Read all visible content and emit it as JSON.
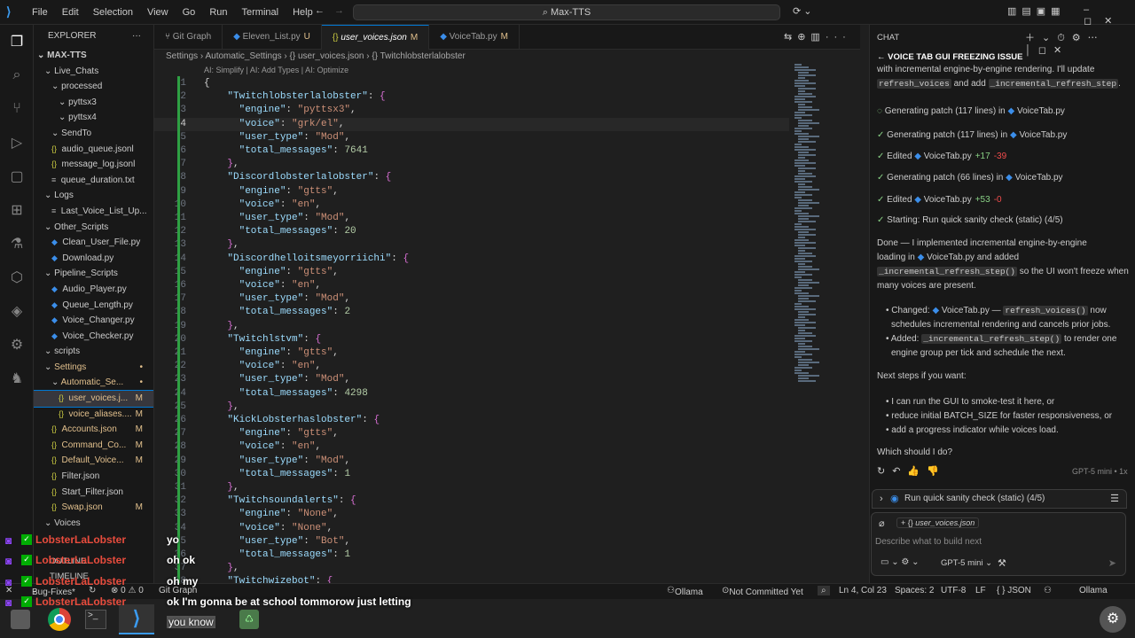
{
  "titlebar": {
    "menu": [
      "File",
      "Edit",
      "Selection",
      "View",
      "Go",
      "Run",
      "Terminal",
      "Help"
    ],
    "search": "Max-TTS"
  },
  "explorer": {
    "header": "EXPLORER",
    "root": "MAX-TTS",
    "items": [
      {
        "label": "Live_Chats",
        "indent": 1,
        "badge": "",
        "icon": "chevron"
      },
      {
        "label": "processed",
        "indent": 2,
        "badge": "",
        "icon": "chevron"
      },
      {
        "label": "pyttsx3",
        "indent": 3,
        "badge": "",
        "icon": "chevron"
      },
      {
        "label": "pyttsx4",
        "indent": 3,
        "badge": "",
        "icon": "chevron"
      },
      {
        "label": "SendTo",
        "indent": 2,
        "badge": "",
        "icon": "chevron"
      },
      {
        "label": "audio_queue.jsonl",
        "indent": 2,
        "badge": "",
        "icon": "json"
      },
      {
        "label": "message_log.jsonl",
        "indent": 2,
        "badge": "",
        "icon": "json"
      },
      {
        "label": "queue_duration.txt",
        "indent": 2,
        "badge": "",
        "icon": "txt"
      },
      {
        "label": "Logs",
        "indent": 1,
        "badge": "",
        "icon": "chevron"
      },
      {
        "label": "Last_Voice_List_Up...",
        "indent": 2,
        "badge": "",
        "icon": "txt"
      },
      {
        "label": "Other_Scripts",
        "indent": 1,
        "badge": "",
        "icon": "chevron"
      },
      {
        "label": "Clean_User_File.py",
        "indent": 2,
        "badge": "",
        "icon": "py"
      },
      {
        "label": "Download.py",
        "indent": 2,
        "badge": "",
        "icon": "py"
      },
      {
        "label": "Pipeline_Scripts",
        "indent": 1,
        "badge": "",
        "icon": "chevron"
      },
      {
        "label": "Audio_Player.py",
        "indent": 2,
        "badge": "",
        "icon": "py"
      },
      {
        "label": "Queue_Length.py",
        "indent": 2,
        "badge": "",
        "icon": "py"
      },
      {
        "label": "Voice_Changer.py",
        "indent": 2,
        "badge": "",
        "icon": "py"
      },
      {
        "label": "Voice_Checker.py",
        "indent": 2,
        "badge": "",
        "icon": "py"
      },
      {
        "label": "scripts",
        "indent": 1,
        "badge": "",
        "icon": "chevron"
      },
      {
        "label": "Settings",
        "indent": 1,
        "badge": "•",
        "icon": "chevron"
      },
      {
        "label": "Automatic_Se...",
        "indent": 2,
        "badge": "•",
        "icon": "chevron"
      },
      {
        "label": "user_voices.j...",
        "indent": 3,
        "badge": "M",
        "icon": "json",
        "selected": true
      },
      {
        "label": "voice_aliases....",
        "indent": 3,
        "badge": "M",
        "icon": "json"
      },
      {
        "label": "Accounts.json",
        "indent": 2,
        "badge": "M",
        "icon": "json"
      },
      {
        "label": "Command_Co...",
        "indent": 2,
        "badge": "M",
        "icon": "json"
      },
      {
        "label": "Default_Voice...",
        "indent": 2,
        "badge": "M",
        "icon": "json"
      },
      {
        "label": "Filter.json",
        "indent": 2,
        "badge": "",
        "icon": "json"
      },
      {
        "label": "Start_Filter.json",
        "indent": 2,
        "badge": "",
        "icon": "json"
      },
      {
        "label": "Swap.json",
        "indent": 2,
        "badge": "M",
        "icon": "json"
      },
      {
        "label": "Voices",
        "indent": 1,
        "badge": "",
        "icon": "chevron"
      }
    ],
    "outline": "OUTLINE",
    "timeline": "TIMELINE"
  },
  "tabs": [
    {
      "label": "Git Graph",
      "mod": "",
      "active": false
    },
    {
      "label": "Eleven_List.py",
      "mod": "U",
      "active": false
    },
    {
      "label": "user_voices.json",
      "mod": "M",
      "active": true
    },
    {
      "label": "VoiceTab.py",
      "mod": "M",
      "active": false
    }
  ],
  "breadcrumb": "Settings  ›  Automatic_Settings  ›  {} user_voices.json  ›  {} Twitchlobsterlalobster",
  "codelens": "AI: Simplify | AI: Add Types | AI: Optimize",
  "code_lines": [
    {
      "n": "1",
      "t": [
        [
          "p",
          "{"
        ]
      ]
    },
    {
      "n": "2",
      "t": [
        [
          "p",
          "    "
        ],
        [
          "k",
          "\"Twitchlobsterlalobster\""
        ],
        [
          "p",
          ": "
        ],
        [
          "b",
          "{"
        ]
      ]
    },
    {
      "n": "3",
      "t": [
        [
          "p",
          "      "
        ],
        [
          "k",
          "\"engine\""
        ],
        [
          "p",
          ": "
        ],
        [
          "s",
          "\"pyttsx3\""
        ],
        [
          "p",
          ","
        ]
      ]
    },
    {
      "n": "4",
      "t": [
        [
          "p",
          "      "
        ],
        [
          "k",
          "\"voice\""
        ],
        [
          "p",
          ": "
        ],
        [
          "s",
          "\"grk/el\""
        ],
        [
          "p",
          ","
        ]
      ]
    },
    {
      "n": "5",
      "t": [
        [
          "p",
          "      "
        ],
        [
          "k",
          "\"user_type\""
        ],
        [
          "p",
          ": "
        ],
        [
          "s",
          "\"Mod\""
        ],
        [
          "p",
          ","
        ]
      ]
    },
    {
      "n": "6",
      "t": [
        [
          "p",
          "      "
        ],
        [
          "k",
          "\"total_messages\""
        ],
        [
          "p",
          ": "
        ],
        [
          "n",
          "7641"
        ]
      ]
    },
    {
      "n": "7",
      "t": [
        [
          "p",
          "    "
        ],
        [
          "b",
          "}"
        ],
        [
          "p",
          ","
        ]
      ]
    },
    {
      "n": "8",
      "t": [
        [
          "p",
          "    "
        ],
        [
          "k",
          "\"Discordlobsterlalobster\""
        ],
        [
          "p",
          ": "
        ],
        [
          "b",
          "{"
        ]
      ]
    },
    {
      "n": "9",
      "t": [
        [
          "p",
          "      "
        ],
        [
          "k",
          "\"engine\""
        ],
        [
          "p",
          ": "
        ],
        [
          "s",
          "\"gtts\""
        ],
        [
          "p",
          ","
        ]
      ]
    },
    {
      "n": "10",
      "t": [
        [
          "p",
          "      "
        ],
        [
          "k",
          "\"voice\""
        ],
        [
          "p",
          ": "
        ],
        [
          "s",
          "\"en\""
        ],
        [
          "p",
          ","
        ]
      ]
    },
    {
      "n": "11",
      "t": [
        [
          "p",
          "      "
        ],
        [
          "k",
          "\"user_type\""
        ],
        [
          "p",
          ": "
        ],
        [
          "s",
          "\"Mod\""
        ],
        [
          "p",
          ","
        ]
      ]
    },
    {
      "n": "12",
      "t": [
        [
          "p",
          "      "
        ],
        [
          "k",
          "\"total_messages\""
        ],
        [
          "p",
          ": "
        ],
        [
          "n",
          "20"
        ]
      ]
    },
    {
      "n": "13",
      "t": [
        [
          "p",
          "    "
        ],
        [
          "b",
          "}"
        ],
        [
          "p",
          ","
        ]
      ]
    },
    {
      "n": "14",
      "t": [
        [
          "p",
          "    "
        ],
        [
          "k",
          "\"Discordhelloitsmeyorriichi\""
        ],
        [
          "p",
          ": "
        ],
        [
          "b",
          "{"
        ]
      ]
    },
    {
      "n": "15",
      "t": [
        [
          "p",
          "      "
        ],
        [
          "k",
          "\"engine\""
        ],
        [
          "p",
          ": "
        ],
        [
          "s",
          "\"gtts\""
        ],
        [
          "p",
          ","
        ]
      ]
    },
    {
      "n": "16",
      "t": [
        [
          "p",
          "      "
        ],
        [
          "k",
          "\"voice\""
        ],
        [
          "p",
          ": "
        ],
        [
          "s",
          "\"en\""
        ],
        [
          "p",
          ","
        ]
      ]
    },
    {
      "n": "17",
      "t": [
        [
          "p",
          "      "
        ],
        [
          "k",
          "\"user_type\""
        ],
        [
          "p",
          ": "
        ],
        [
          "s",
          "\"Mod\""
        ],
        [
          "p",
          ","
        ]
      ]
    },
    {
      "n": "18",
      "t": [
        [
          "p",
          "      "
        ],
        [
          "k",
          "\"total_messages\""
        ],
        [
          "p",
          ": "
        ],
        [
          "n",
          "2"
        ]
      ]
    },
    {
      "n": "19",
      "t": [
        [
          "p",
          "    "
        ],
        [
          "b",
          "}"
        ],
        [
          "p",
          ","
        ]
      ]
    },
    {
      "n": "20",
      "t": [
        [
          "p",
          "    "
        ],
        [
          "k",
          "\"Twitchlstvm\""
        ],
        [
          "p",
          ": "
        ],
        [
          "b",
          "{"
        ]
      ]
    },
    {
      "n": "21",
      "t": [
        [
          "p",
          "      "
        ],
        [
          "k",
          "\"engine\""
        ],
        [
          "p",
          ": "
        ],
        [
          "s",
          "\"gtts\""
        ],
        [
          "p",
          ","
        ]
      ]
    },
    {
      "n": "22",
      "t": [
        [
          "p",
          "      "
        ],
        [
          "k",
          "\"voice\""
        ],
        [
          "p",
          ": "
        ],
        [
          "s",
          "\"en\""
        ],
        [
          "p",
          ","
        ]
      ]
    },
    {
      "n": "23",
      "t": [
        [
          "p",
          "      "
        ],
        [
          "k",
          "\"user_type\""
        ],
        [
          "p",
          ": "
        ],
        [
          "s",
          "\"Mod\""
        ],
        [
          "p",
          ","
        ]
      ]
    },
    {
      "n": "24",
      "t": [
        [
          "p",
          "      "
        ],
        [
          "k",
          "\"total_messages\""
        ],
        [
          "p",
          ": "
        ],
        [
          "n",
          "4298"
        ]
      ]
    },
    {
      "n": "25",
      "t": [
        [
          "p",
          "    "
        ],
        [
          "b",
          "}"
        ],
        [
          "p",
          ","
        ]
      ]
    },
    {
      "n": "26",
      "t": [
        [
          "p",
          "    "
        ],
        [
          "k",
          "\"KickLobsterhaslobster\""
        ],
        [
          "p",
          ": "
        ],
        [
          "b",
          "{"
        ]
      ]
    },
    {
      "n": "27",
      "t": [
        [
          "p",
          "      "
        ],
        [
          "k",
          "\"engine\""
        ],
        [
          "p",
          ": "
        ],
        [
          "s",
          "\"gtts\""
        ],
        [
          "p",
          ","
        ]
      ]
    },
    {
      "n": "28",
      "t": [
        [
          "p",
          "      "
        ],
        [
          "k",
          "\"voice\""
        ],
        [
          "p",
          ": "
        ],
        [
          "s",
          "\"en\""
        ],
        [
          "p",
          ","
        ]
      ]
    },
    {
      "n": "29",
      "t": [
        [
          "p",
          "      "
        ],
        [
          "k",
          "\"user_type\""
        ],
        [
          "p",
          ": "
        ],
        [
          "s",
          "\"Mod\""
        ],
        [
          "p",
          ","
        ]
      ]
    },
    {
      "n": "30",
      "t": [
        [
          "p",
          "      "
        ],
        [
          "k",
          "\"total_messages\""
        ],
        [
          "p",
          ": "
        ],
        [
          "n",
          "1"
        ]
      ]
    },
    {
      "n": "31",
      "t": [
        [
          "p",
          "    "
        ],
        [
          "b",
          "}"
        ],
        [
          "p",
          ","
        ]
      ]
    },
    {
      "n": "32",
      "t": [
        [
          "p",
          "    "
        ],
        [
          "k",
          "\"Twitchsoundalerts\""
        ],
        [
          "p",
          ": "
        ],
        [
          "b",
          "{"
        ]
      ]
    },
    {
      "n": "33",
      "t": [
        [
          "p",
          "      "
        ],
        [
          "k",
          "\"engine\""
        ],
        [
          "p",
          ": "
        ],
        [
          "s",
          "\"None\""
        ],
        [
          "p",
          ","
        ]
      ]
    },
    {
      "n": "34",
      "t": [
        [
          "p",
          "      "
        ],
        [
          "k",
          "\"voice\""
        ],
        [
          "p",
          ": "
        ],
        [
          "s",
          "\"None\""
        ],
        [
          "p",
          ","
        ]
      ]
    },
    {
      "n": "35",
      "t": [
        [
          "p",
          "      "
        ],
        [
          "k",
          "\"user_type\""
        ],
        [
          "p",
          ": "
        ],
        [
          "s",
          "\"Bot\""
        ],
        [
          "p",
          ","
        ]
      ]
    },
    {
      "n": "36",
      "t": [
        [
          "p",
          "      "
        ],
        [
          "k",
          "\"total_messages\""
        ],
        [
          "p",
          ": "
        ],
        [
          "n",
          "1"
        ]
      ]
    },
    {
      "n": "37",
      "t": [
        [
          "p",
          "    "
        ],
        [
          "b",
          "}"
        ],
        [
          "p",
          ","
        ]
      ]
    },
    {
      "n": "38",
      "t": [
        [
          "p",
          "    "
        ],
        [
          "k",
          "\"Twitchwizebot\""
        ],
        [
          "p",
          ": "
        ],
        [
          "b",
          "{"
        ]
      ]
    }
  ],
  "chat": {
    "title": "CHAT",
    "thread_title": "VOICE TAB GUI FREEZING ISSUE",
    "intro1": "with incremental engine-by-engine rendering. I'll update",
    "intro2_a": "refresh_voices",
    "intro2_b": " and add ",
    "intro2_c": "_incremental_refresh_step",
    "intro2_d": ".",
    "steps": [
      {
        "text": "Generating patch (117 lines) in",
        "file": "VoiceTab.py",
        "diff": "",
        "running": true
      },
      {
        "text": "Generating patch (117 lines) in",
        "file": "VoiceTab.py",
        "diff": ""
      },
      {
        "text": "Edited",
        "file": "VoiceTab.py",
        "plus": "+17",
        "minus": "-39"
      },
      {
        "text": "Generating patch (66 lines) in",
        "file": "VoiceTab.py",
        "diff": ""
      },
      {
        "text": "Edited",
        "file": "VoiceTab.py",
        "plus": "+53",
        "minus": "-0"
      },
      {
        "text": "Starting: Run quick sanity check (static) (4/5)",
        "file": "",
        "diff": ""
      }
    ],
    "done1": "Done — I implemented incremental engine-by-engine",
    "done2_a": "loading in",
    "done2_file": "VoiceTab.py",
    "done2_b": "and added",
    "done3_code": "_incremental_refresh_step()",
    "done3_b": "so the UI won't freeze when",
    "done4": "many voices are present.",
    "changed_label": "Changed:",
    "changed_file": "VoiceTab.py",
    "changed_dash": "—",
    "changed_code": "refresh_voices()",
    "changed_rest": "now",
    "changed_line2": "schedules incremental rendering and cancels prior jobs.",
    "added_label": "Added:",
    "added_code": "_incremental_refresh_step()",
    "added_rest": "to render one",
    "added_line2": "engine group per tick and schedule the next.",
    "next_steps": "Next steps if you want:",
    "options": [
      "I can run the GUI to smoke-test it here, or",
      "reduce initial BATCH_SIZE for faster responsiveness, or",
      "add a progress indicator while voices load."
    ],
    "question": "Which should I do?",
    "model_tag": "GPT-5 mini • 1x",
    "todo": "Run quick sanity check (static) (4/5)",
    "attachment": "user_voices.json",
    "placeholder": "Describe what to build next",
    "model_select": "GPT-5 mini"
  },
  "statusbar": {
    "branch": "Bug-Fixes*",
    "problems": "⊗ 0 ⚠ 0",
    "gitgraph": "Git Graph",
    "ollama1": "Ollama",
    "not_committed": "Not Committed Yet",
    "position": "Ln 4, Col 23",
    "spaces": "Spaces: 2",
    "encoding": "UTF-8",
    "eol": "LF",
    "language": "{ } JSON",
    "ollama2": "Ollama"
  },
  "overlay": [
    {
      "name": "LobsterLaLobster",
      "msg": "yo"
    },
    {
      "name": "LobsterLaLobster",
      "msg": "oh ok"
    },
    {
      "name": "LobsterLaLobster",
      "msg": "oh my"
    },
    {
      "name": "LobsterLaLobster",
      "msg": "ok I'm gonna be at school tommorow just letting"
    },
    {
      "name": "",
      "msg": "you know"
    }
  ],
  "colors": {
    "accent": "#0078d4",
    "modified": "#e2c08d",
    "added": "#2ea043",
    "chat_name": "#e84c3d"
  }
}
